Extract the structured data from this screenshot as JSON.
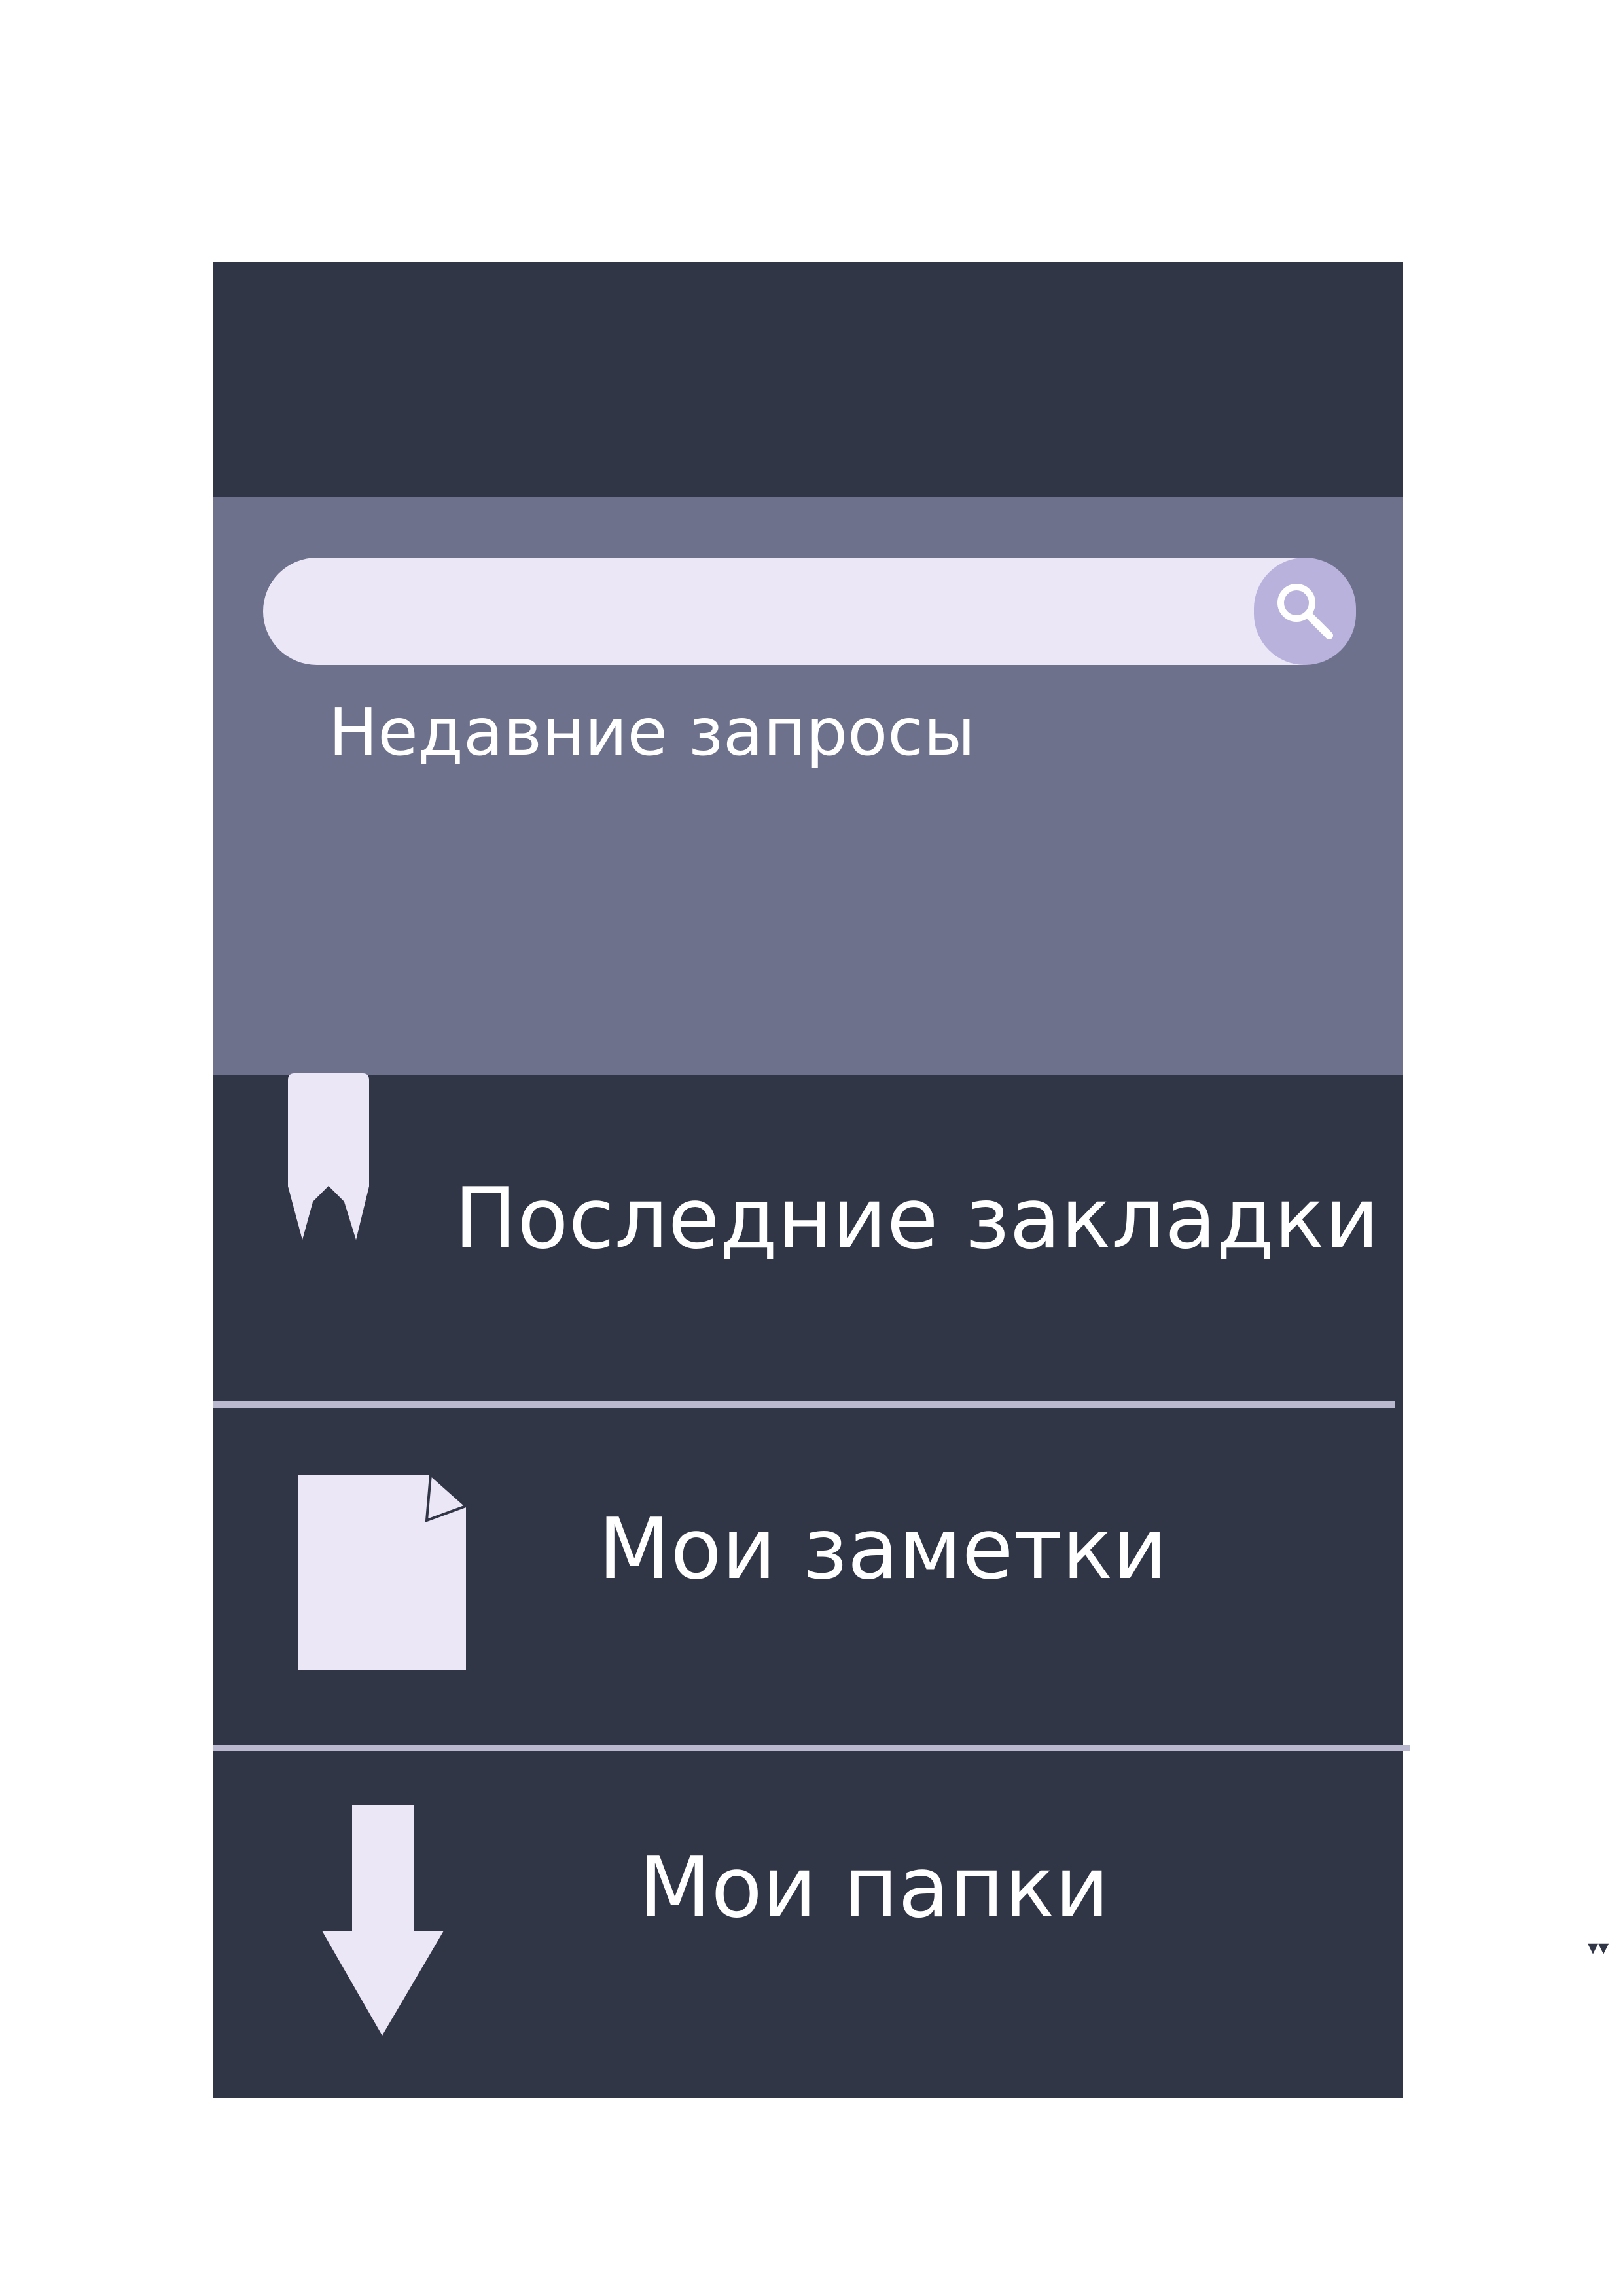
{
  "colors": {
    "panel_dark": "#313646",
    "search_area": "#6d718c",
    "search_field": "#ebe7f7",
    "search_button": "#b8b2dc",
    "divider": "#b9b8cf",
    "icon_fill": "#ebe7f7",
    "text": "#ffffff"
  },
  "search": {
    "value": "",
    "button_icon": "search-icon"
  },
  "recent_queries": {
    "label": "Недавние запросы"
  },
  "menu": {
    "items": [
      {
        "label": "Последние закладки",
        "icon": "bookmark-icon"
      },
      {
        "label": "Мои заметки",
        "icon": "document-icon"
      },
      {
        "label": "Мои папки",
        "icon": "arrow-down-icon"
      }
    ]
  }
}
